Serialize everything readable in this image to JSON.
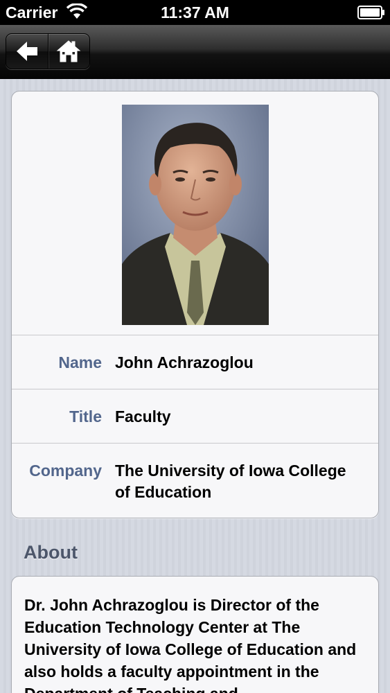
{
  "status_bar": {
    "carrier": "Carrier",
    "time": "11:37 AM"
  },
  "nav": {
    "back_icon": "back-arrow-icon",
    "home_icon": "home-icon"
  },
  "profile": {
    "photo_alt": "John Achrazoglou",
    "fields": [
      {
        "label": "Name",
        "value": "John Achrazoglou"
      },
      {
        "label": "Title",
        "value": "Faculty"
      },
      {
        "label": "Company",
        "value": "The University of Iowa College of Education"
      }
    ]
  },
  "about": {
    "heading": "About",
    "text": "Dr. John Achrazoglou is Director of the Education Technology Center at The University of Iowa College of Education and also holds a faculty appointment in the Department of Teaching and"
  },
  "colors": {
    "label": "#52668c",
    "nav": "#1a1a1a"
  }
}
